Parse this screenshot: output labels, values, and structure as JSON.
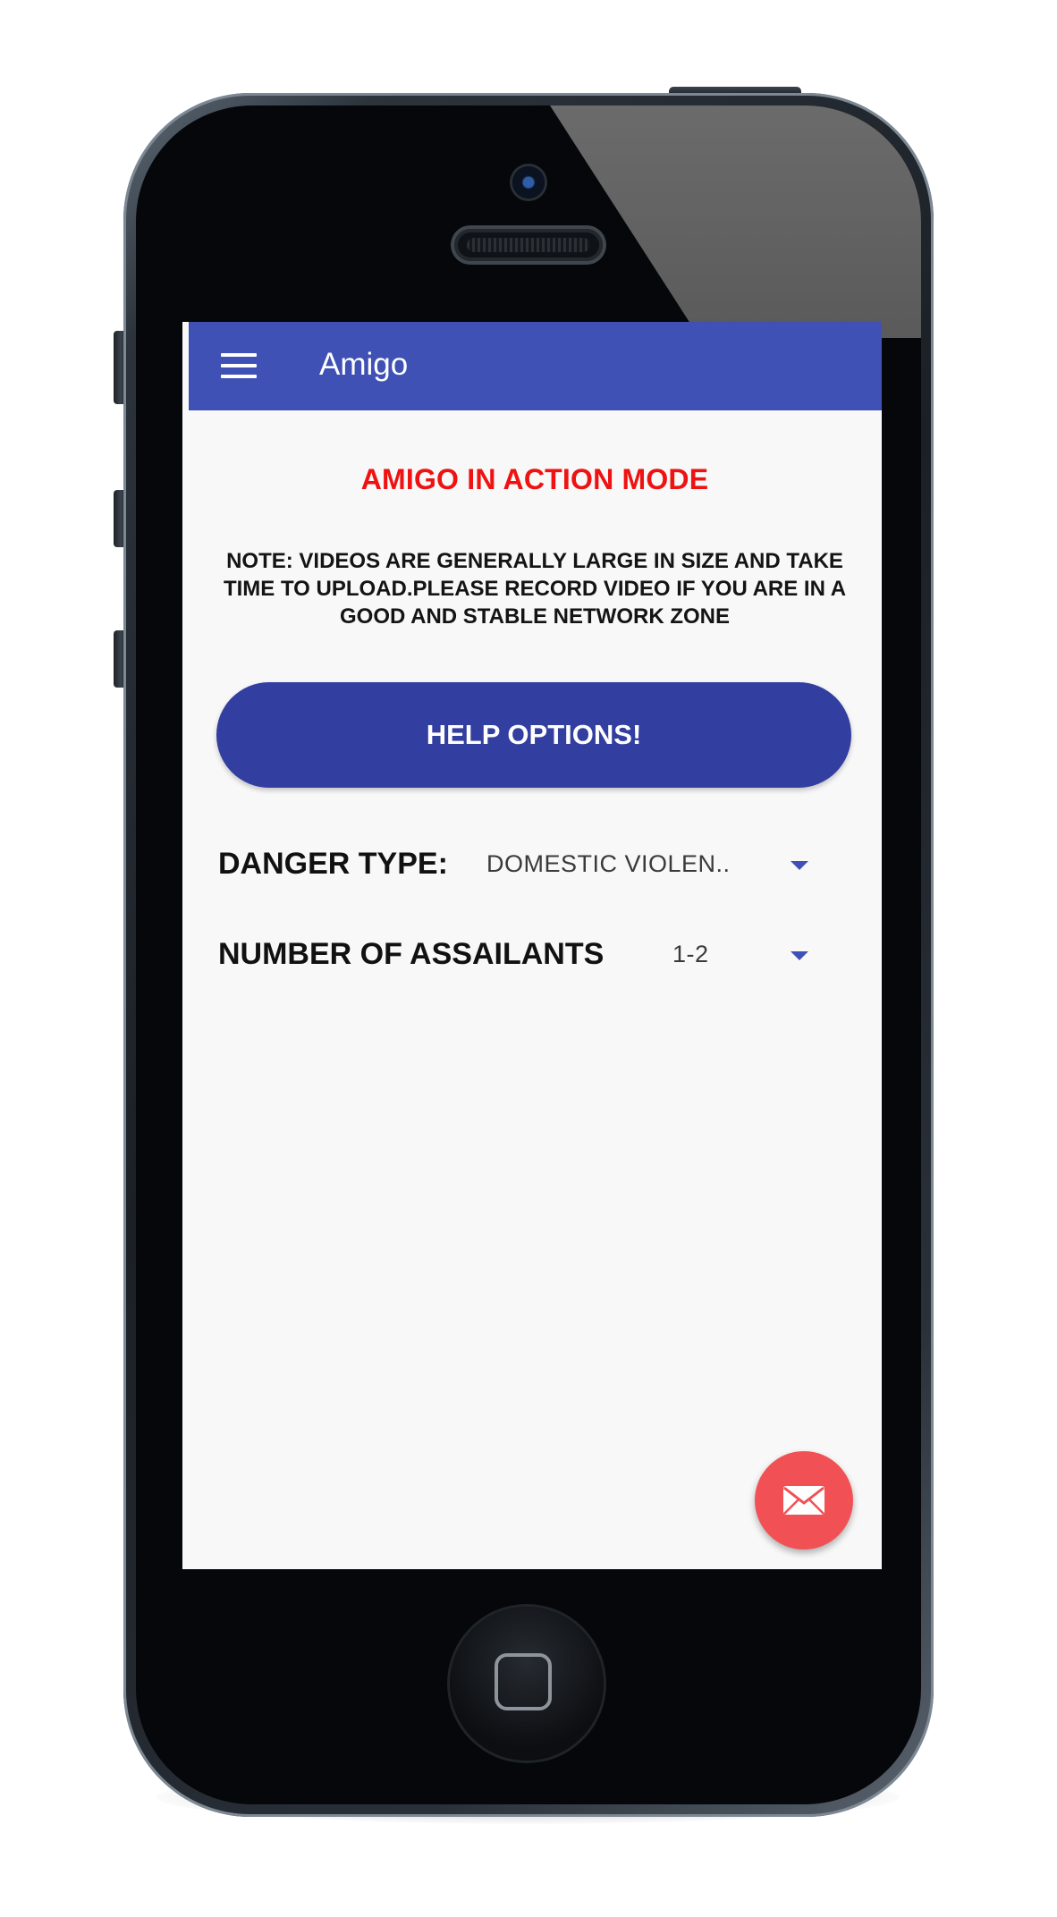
{
  "app": {
    "title": "Amigo"
  },
  "main": {
    "mode_title": "AMIGO IN ACTION MODE",
    "note": "NOTE: VIDEOS ARE GENERALLY LARGE IN SIZE AND TAKE TIME TO UPLOAD.PLEASE RECORD VIDEO IF YOU ARE IN A GOOD AND STABLE NETWORK ZONE",
    "help_button_label": "HELP OPTIONS!",
    "danger_type": {
      "label": "DANGER TYPE:",
      "selected": "DOMESTIC VIOLEN.."
    },
    "assailants": {
      "label": "NUMBER OF ASSAILANTS",
      "selected": "1-2"
    }
  },
  "icons": {
    "menu": "menu-icon",
    "fab": "envelope-icon",
    "dropdown": "caret-down-icon"
  },
  "colors": {
    "app_bar": "#3f51b5",
    "mode_title": "#ee1212",
    "help_button": "#323ea0",
    "fab": "#f15155",
    "caret": "#3f51b5"
  }
}
